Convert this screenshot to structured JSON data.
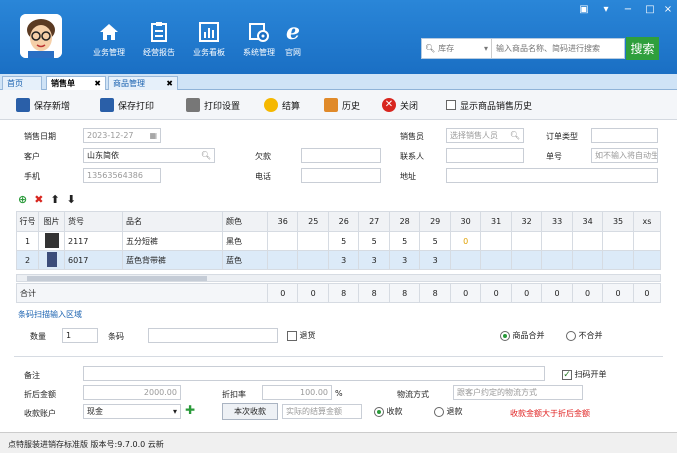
{
  "nav": [
    {
      "label": "业务管理",
      "icon": "home-icon"
    },
    {
      "label": "经营报告",
      "icon": "report-icon"
    },
    {
      "label": "业务看板",
      "icon": "dashboard-icon"
    },
    {
      "label": "系统管理",
      "icon": "settings-icon"
    },
    {
      "label": "官网",
      "icon": "browser-icon"
    }
  ],
  "search": {
    "category": "库存",
    "placeholder": "输入商品名称、简码进行搜索",
    "button": "搜索"
  },
  "tabs": [
    {
      "label": "首页"
    },
    {
      "label": "销售单"
    },
    {
      "label": "商品管理"
    }
  ],
  "toolbar": {
    "save_new": "保存新增",
    "save_print": "保存打印",
    "print_settings": "打印设置",
    "settle": "结算",
    "history": "历史",
    "close": "关闭",
    "show_history": "显示商品销售历史"
  },
  "form": {
    "sale_date_label": "销售日期",
    "sale_date": "2023-12-27",
    "customer_label": "客户",
    "customer": "山东简依",
    "phone_label": "手机",
    "phone": "13563564386",
    "debt_label": "欠款",
    "tel_label": "电话",
    "seller_label": "销售员",
    "seller_placeholder": "选择销售人员",
    "contact_label": "联系人",
    "address_label": "地址",
    "order_type_label": "订单类型",
    "order_no_label": "单号",
    "order_no_placeholder": "如不输入将自动生"
  },
  "grid": {
    "headers": {
      "row": "行号",
      "img": "图片",
      "code": "货号",
      "name": "品名",
      "color": "颜色"
    },
    "sizes": [
      "36",
      "25",
      "26",
      "27",
      "28",
      "29",
      "30",
      "31",
      "32",
      "33",
      "34",
      "35",
      "xs"
    ],
    "rows": [
      {
        "no": "1",
        "code": "2117",
        "name": "五分短裤",
        "color": "黑色",
        "qty": [
          "",
          "",
          "5",
          "5",
          "5",
          "5",
          "0",
          "",
          "",
          "",
          "",
          "",
          ""
        ]
      },
      {
        "no": "2",
        "code": "6017",
        "name": "蓝色背带裤",
        "color": "蓝色",
        "qty": [
          "",
          "",
          "3",
          "3",
          "3",
          "3",
          "",
          "",
          "",
          "",
          "",
          "",
          ""
        ]
      }
    ],
    "total_label": "合计",
    "totals": [
      "0",
      "0",
      "8",
      "8",
      "8",
      "8",
      "0",
      "0",
      "0",
      "0",
      "0",
      "0",
      "0"
    ]
  },
  "barcode": {
    "section_label": "条码扫描输入区域",
    "qty_label": "数量",
    "qty": "1",
    "barcode_label": "条码",
    "return_label": "退货",
    "merge_label": "商品合并",
    "nomerge_label": "不合并"
  },
  "bottom": {
    "remark_label": "备注",
    "scan_open_label": "扫码开单",
    "discount_amt_label": "折后金额",
    "discount_amt": "2000.00",
    "discount_rate_label": "折扣率",
    "discount_rate": "100.00",
    "percent": "%",
    "logistics_label": "物流方式",
    "logistics_placeholder": "跟客户约定的物流方式",
    "account_label": "收款账户",
    "account": "现金",
    "receive_btn": "本次收款",
    "receive_placeholder": "实际的结算金额",
    "receipt_label": "收款",
    "refund_label": "退款",
    "warning": "收款金额大于折后金额"
  },
  "footer": {
    "text": "点特服装进销存标准版  版本号:9.7.0.0 云新"
  },
  "colors": {
    "brand": "#1a6fc4",
    "search_btn": "#2f9f3c",
    "warning": "#e02020"
  }
}
